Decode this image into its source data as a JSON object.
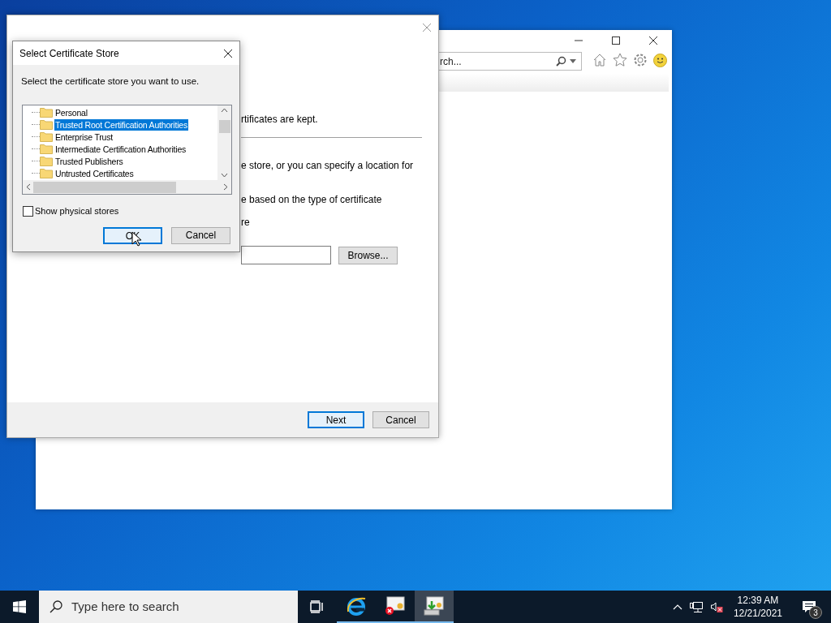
{
  "browser_window": {
    "search": {
      "placeholder": "rch..."
    }
  },
  "wizard": {
    "texts": [
      "rtificates are kept.",
      "e store, or you can specify a location for",
      "e based on the type of certificate",
      "re"
    ],
    "browse_button": "Browse...",
    "buttons": [
      {
        "label": "Next",
        "default": true
      },
      {
        "label": "Cancel",
        "default": false
      }
    ]
  },
  "dialog": {
    "title": "Select Certificate Store",
    "prompt": "Select the certificate store you want to use.",
    "stores": [
      {
        "label": "Personal",
        "selected": false
      },
      {
        "label": "Trusted Root Certification Authorities",
        "selected": true
      },
      {
        "label": "Enterprise Trust",
        "selected": false
      },
      {
        "label": "Intermediate Certification Authorities",
        "selected": false
      },
      {
        "label": "Trusted Publishers",
        "selected": false
      },
      {
        "label": "Untrusted Certificates",
        "selected": false
      }
    ],
    "show_physical_stores": {
      "label": "Show physical stores",
      "checked": false
    },
    "buttons": [
      {
        "label": "OK",
        "default": true
      },
      {
        "label": "Cancel",
        "default": false
      }
    ]
  },
  "taskbar": {
    "search": {
      "placeholder": "Type here to search"
    },
    "apps": [
      {
        "kind": "task-view",
        "active": false
      },
      {
        "kind": "browser",
        "active": false
      },
      {
        "kind": "certificate-error",
        "active": false
      },
      {
        "kind": "certificate-import",
        "active": true
      }
    ],
    "clock": {
      "time": "12:39 AM",
      "date": "12/21/2021"
    },
    "notifications": {
      "count": "3"
    }
  }
}
